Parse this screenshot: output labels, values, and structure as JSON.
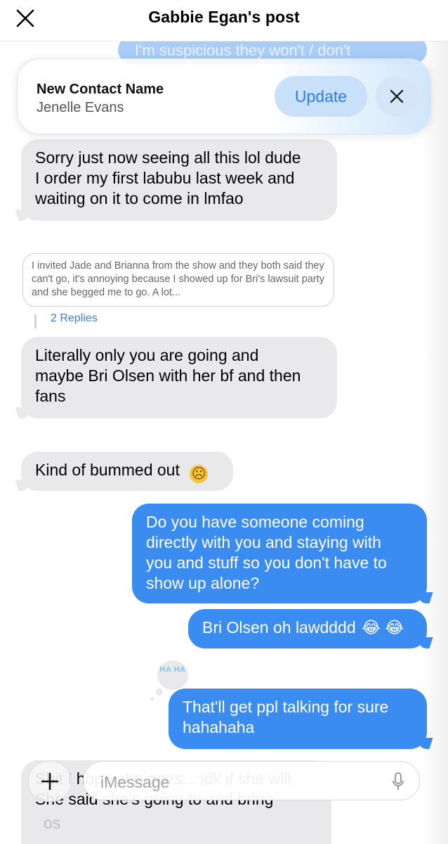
{
  "header": {
    "title": "Gabbie Egan's post",
    "close_icon": "close-icon"
  },
  "banner": {
    "title": "New Contact Name",
    "subtitle": "Jenelle Evans",
    "update_label": "Update",
    "dismiss_icon": "close-icon"
  },
  "messages": {
    "faded_top_text": "I'm suspicious they won't / don't",
    "m1": [
      "Sorry just now seeing all this lol dude",
      "I order my first labubu last week and",
      "waiting on it to come in lmfao"
    ],
    "reply_preview": "I invited Jade and Brianna from the show and they both said they can't go, it's annoying because I showed up for Bri's lawsuit party and she begged me to go. A lot...",
    "replies_link": "2 Replies",
    "m2": [
      "Literally only you are going and",
      "maybe Bri Olsen with her bf and then",
      "fans"
    ],
    "m3": "Kind of bummed out",
    "m3_emoji": "☹",
    "m4": [
      "Do you have someone coming",
      "directly with you and staying with",
      "you and stuff so you don't have to",
      "show up alone?"
    ],
    "m5": "Bri Olsen oh lawdddd",
    "m5_emoji": "😂 😂",
    "tapback": "HA HA",
    "m6": [
      "That'll get ppl talking for sure",
      "hahahaha"
    ],
    "m7": [
      "Shit I hope she goes... idk if she will.",
      "She said she's going to and bring"
    ]
  },
  "compose": {
    "placeholder": "iMessage",
    "ghost_text": "os",
    "plus_icon": "plus-icon",
    "mic_icon": "microphone-icon"
  },
  "colors": {
    "incoming": "#e9e9eb",
    "outgoing": "#3b8cf0",
    "accent": "#2d7de6"
  }
}
